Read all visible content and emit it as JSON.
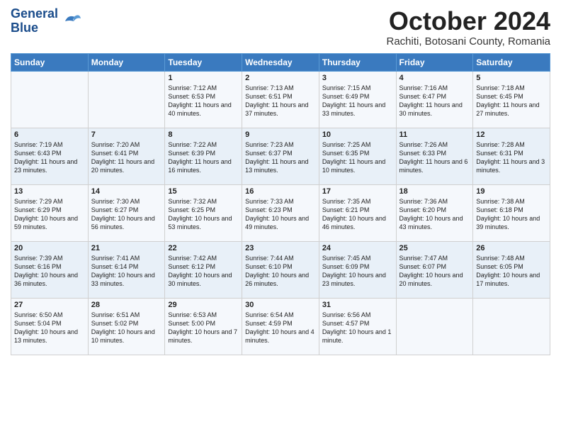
{
  "header": {
    "logo_line1": "General",
    "logo_line2": "Blue",
    "month_title": "October 2024",
    "location": "Rachiti, Botosani County, Romania"
  },
  "weekdays": [
    "Sunday",
    "Monday",
    "Tuesday",
    "Wednesday",
    "Thursday",
    "Friday",
    "Saturday"
  ],
  "weeks": [
    [
      {
        "day": "",
        "text": ""
      },
      {
        "day": "",
        "text": ""
      },
      {
        "day": "1",
        "text": "Sunrise: 7:12 AM\nSunset: 6:53 PM\nDaylight: 11 hours and 40 minutes."
      },
      {
        "day": "2",
        "text": "Sunrise: 7:13 AM\nSunset: 6:51 PM\nDaylight: 11 hours and 37 minutes."
      },
      {
        "day": "3",
        "text": "Sunrise: 7:15 AM\nSunset: 6:49 PM\nDaylight: 11 hours and 33 minutes."
      },
      {
        "day": "4",
        "text": "Sunrise: 7:16 AM\nSunset: 6:47 PM\nDaylight: 11 hours and 30 minutes."
      },
      {
        "day": "5",
        "text": "Sunrise: 7:18 AM\nSunset: 6:45 PM\nDaylight: 11 hours and 27 minutes."
      }
    ],
    [
      {
        "day": "6",
        "text": "Sunrise: 7:19 AM\nSunset: 6:43 PM\nDaylight: 11 hours and 23 minutes."
      },
      {
        "day": "7",
        "text": "Sunrise: 7:20 AM\nSunset: 6:41 PM\nDaylight: 11 hours and 20 minutes."
      },
      {
        "day": "8",
        "text": "Sunrise: 7:22 AM\nSunset: 6:39 PM\nDaylight: 11 hours and 16 minutes."
      },
      {
        "day": "9",
        "text": "Sunrise: 7:23 AM\nSunset: 6:37 PM\nDaylight: 11 hours and 13 minutes."
      },
      {
        "day": "10",
        "text": "Sunrise: 7:25 AM\nSunset: 6:35 PM\nDaylight: 11 hours and 10 minutes."
      },
      {
        "day": "11",
        "text": "Sunrise: 7:26 AM\nSunset: 6:33 PM\nDaylight: 11 hours and 6 minutes."
      },
      {
        "day": "12",
        "text": "Sunrise: 7:28 AM\nSunset: 6:31 PM\nDaylight: 11 hours and 3 minutes."
      }
    ],
    [
      {
        "day": "13",
        "text": "Sunrise: 7:29 AM\nSunset: 6:29 PM\nDaylight: 10 hours and 59 minutes."
      },
      {
        "day": "14",
        "text": "Sunrise: 7:30 AM\nSunset: 6:27 PM\nDaylight: 10 hours and 56 minutes."
      },
      {
        "day": "15",
        "text": "Sunrise: 7:32 AM\nSunset: 6:25 PM\nDaylight: 10 hours and 53 minutes."
      },
      {
        "day": "16",
        "text": "Sunrise: 7:33 AM\nSunset: 6:23 PM\nDaylight: 10 hours and 49 minutes."
      },
      {
        "day": "17",
        "text": "Sunrise: 7:35 AM\nSunset: 6:21 PM\nDaylight: 10 hours and 46 minutes."
      },
      {
        "day": "18",
        "text": "Sunrise: 7:36 AM\nSunset: 6:20 PM\nDaylight: 10 hours and 43 minutes."
      },
      {
        "day": "19",
        "text": "Sunrise: 7:38 AM\nSunset: 6:18 PM\nDaylight: 10 hours and 39 minutes."
      }
    ],
    [
      {
        "day": "20",
        "text": "Sunrise: 7:39 AM\nSunset: 6:16 PM\nDaylight: 10 hours and 36 minutes."
      },
      {
        "day": "21",
        "text": "Sunrise: 7:41 AM\nSunset: 6:14 PM\nDaylight: 10 hours and 33 minutes."
      },
      {
        "day": "22",
        "text": "Sunrise: 7:42 AM\nSunset: 6:12 PM\nDaylight: 10 hours and 30 minutes."
      },
      {
        "day": "23",
        "text": "Sunrise: 7:44 AM\nSunset: 6:10 PM\nDaylight: 10 hours and 26 minutes."
      },
      {
        "day": "24",
        "text": "Sunrise: 7:45 AM\nSunset: 6:09 PM\nDaylight: 10 hours and 23 minutes."
      },
      {
        "day": "25",
        "text": "Sunrise: 7:47 AM\nSunset: 6:07 PM\nDaylight: 10 hours and 20 minutes."
      },
      {
        "day": "26",
        "text": "Sunrise: 7:48 AM\nSunset: 6:05 PM\nDaylight: 10 hours and 17 minutes."
      }
    ],
    [
      {
        "day": "27",
        "text": "Sunrise: 6:50 AM\nSunset: 5:04 PM\nDaylight: 10 hours and 13 minutes."
      },
      {
        "day": "28",
        "text": "Sunrise: 6:51 AM\nSunset: 5:02 PM\nDaylight: 10 hours and 10 minutes."
      },
      {
        "day": "29",
        "text": "Sunrise: 6:53 AM\nSunset: 5:00 PM\nDaylight: 10 hours and 7 minutes."
      },
      {
        "day": "30",
        "text": "Sunrise: 6:54 AM\nSunset: 4:59 PM\nDaylight: 10 hours and 4 minutes."
      },
      {
        "day": "31",
        "text": "Sunrise: 6:56 AM\nSunset: 4:57 PM\nDaylight: 10 hours and 1 minute."
      },
      {
        "day": "",
        "text": ""
      },
      {
        "day": "",
        "text": ""
      }
    ]
  ]
}
